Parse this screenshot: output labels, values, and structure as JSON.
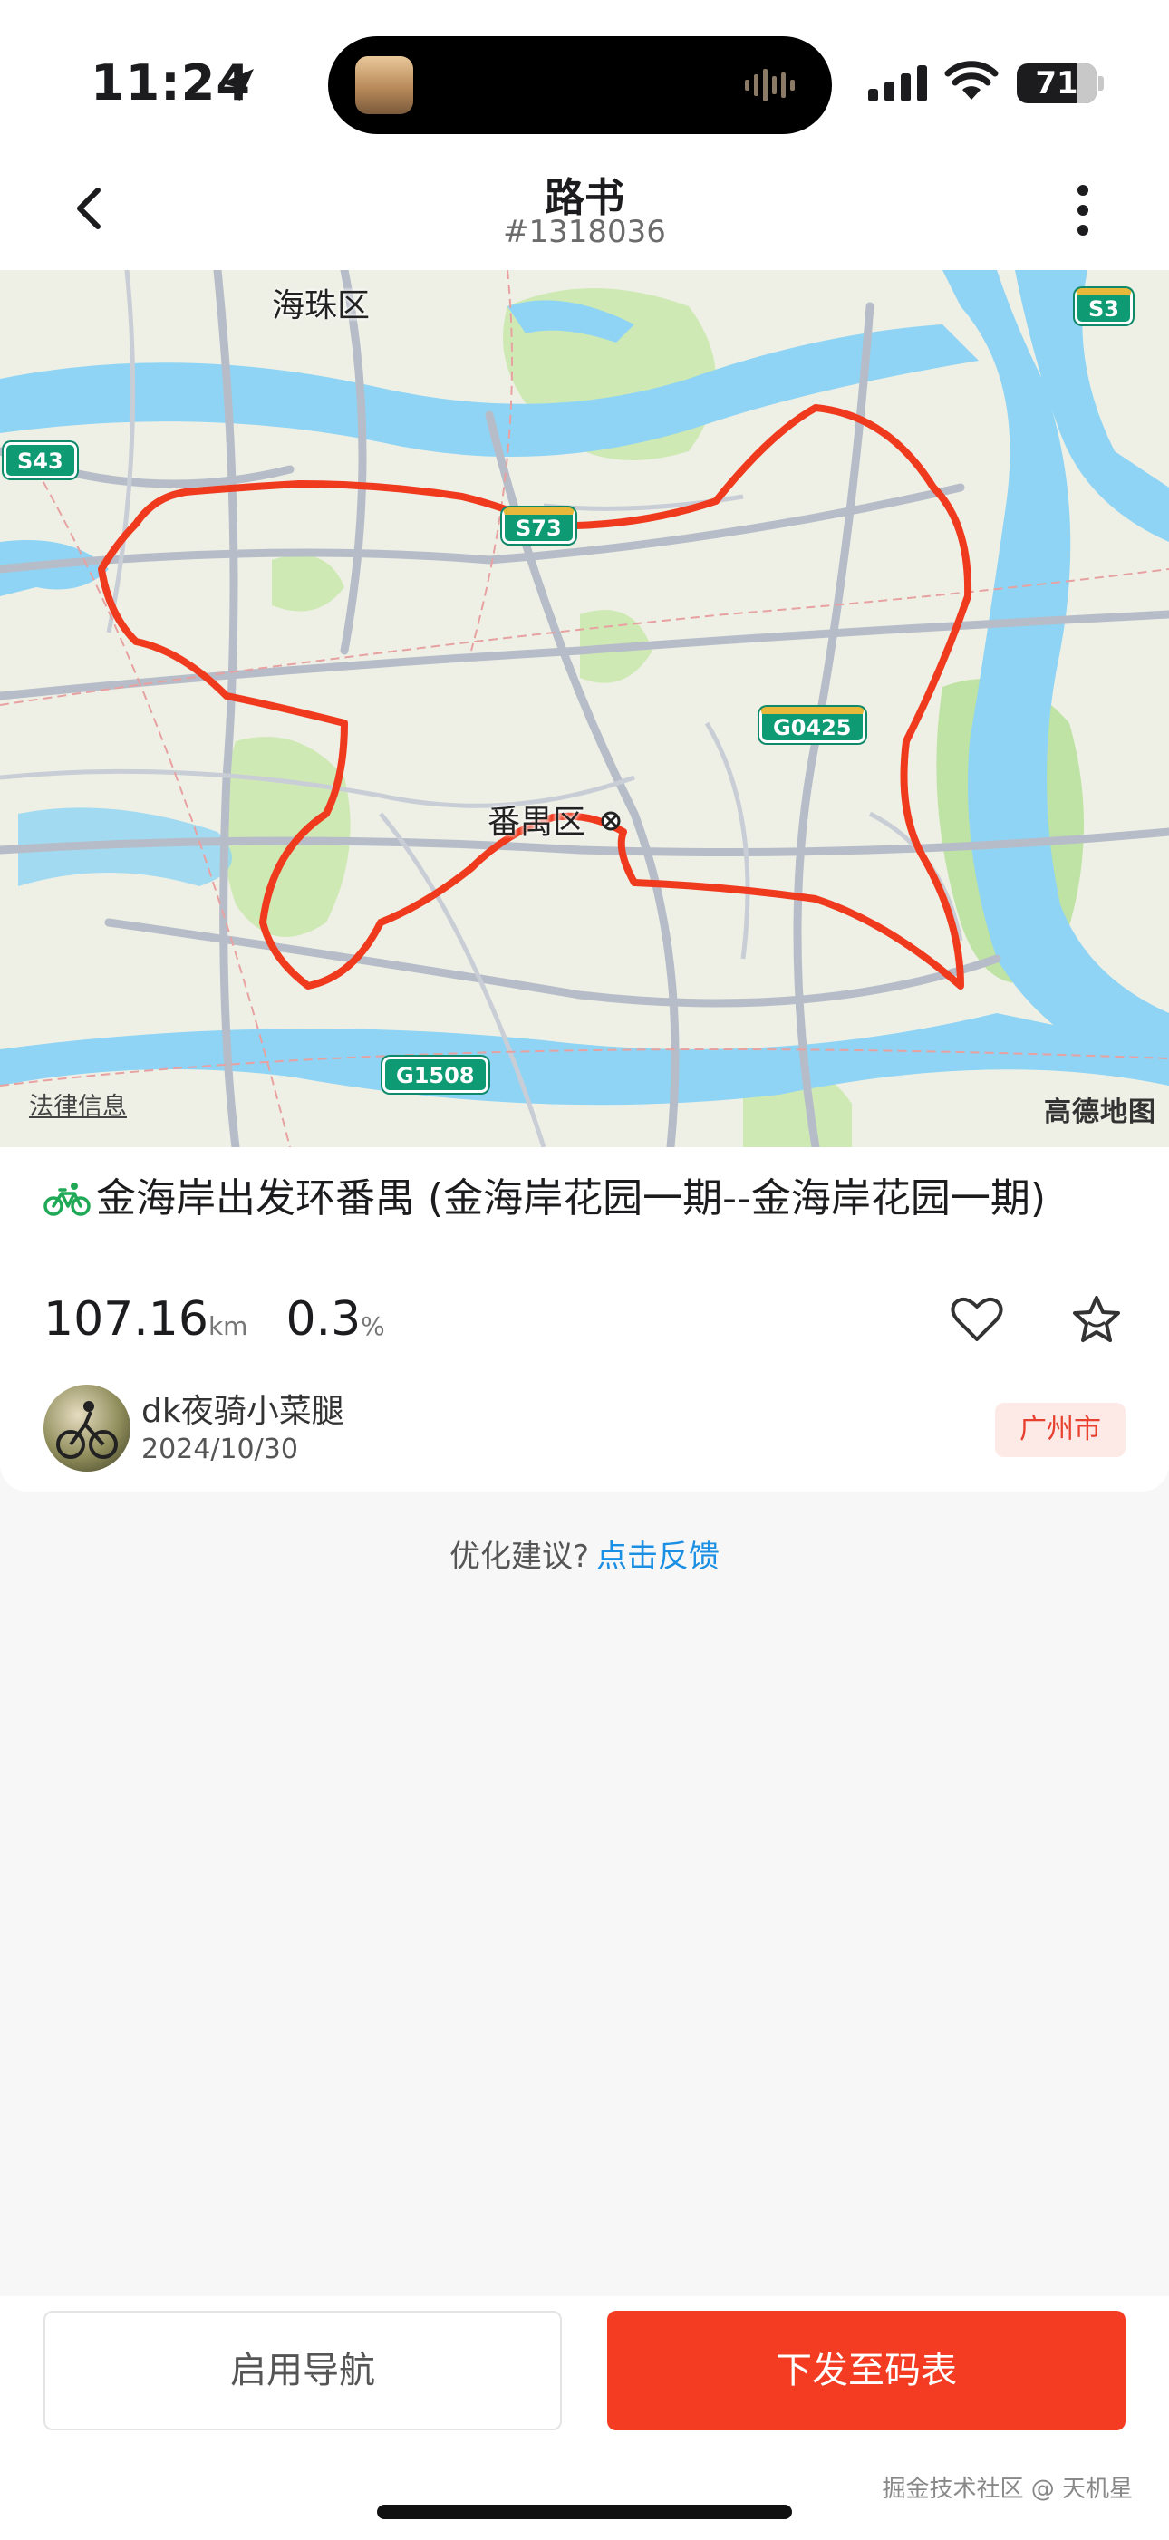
{
  "status_bar": {
    "time": "11:24",
    "battery": "71"
  },
  "nav": {
    "title": "路书",
    "subtitle": "#1318036"
  },
  "map": {
    "labels": {
      "district_north": "海珠区",
      "district_center": "番禺区"
    },
    "shields": {
      "s43": "S43",
      "s73": "S73",
      "s3": "S3",
      "g0425": "G0425",
      "g1508": "G1508"
    },
    "legal": "法律信息",
    "provider": "高德地图",
    "colors": {
      "route": "#f03a1e",
      "water": "#8fd4f4",
      "green": "#cfe9b5"
    }
  },
  "route": {
    "title": "金海岸出发环番禺 (金海岸花园一期--金海岸花园一期)",
    "distance": "107.16",
    "distance_unit": "km",
    "grade": "0.3",
    "grade_unit": "%",
    "author": "dk夜骑小菜腿",
    "date": "2024/10/30",
    "city": "广州市"
  },
  "feedback": {
    "prompt": "优化建议?",
    "link": "点击反馈"
  },
  "actions": {
    "navigate": "启用导航",
    "send": "下发至码表"
  },
  "watermark": "掘金技术社区 @ 天机星"
}
